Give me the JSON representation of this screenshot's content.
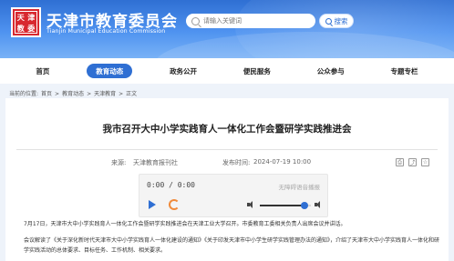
{
  "header": {
    "logo_chars": [
      "天",
      "津",
      "教",
      "委"
    ],
    "title": "天津市教育委员会",
    "subtitle": "Tianjin Municipal Education Commission",
    "search_placeholder": "请输入关键词",
    "search_button": "搜索"
  },
  "nav": {
    "items": [
      {
        "label": "首页",
        "active": false
      },
      {
        "label": "教育动态",
        "active": true
      },
      {
        "label": "政务公开",
        "active": false
      },
      {
        "label": "便民服务",
        "active": false
      },
      {
        "label": "公众参与",
        "active": false
      },
      {
        "label": "专题专栏",
        "active": false
      }
    ]
  },
  "breadcrumb": {
    "prefix": "当前的位置:",
    "items": [
      "首页",
      "教育动态",
      "天津教育",
      "正文"
    ],
    "separator": ">"
  },
  "article": {
    "title": "我市召开大中小学实践育人一体化工作会暨研学实践推进会",
    "source_label": "来源:",
    "source_value": "天津教育报刊社",
    "date_label": "发布时间:",
    "date_value": "2024-07-19 10:00",
    "paragraph_1": "7月17日，天津市大中小学实践育人一体化工作会暨研学实践推进会在天津工业大学召开。市委教育工委相关负责人出席会议并讲话。",
    "paragraph_2": "会议解读了《关于深化新时代天津市大中小学实践育人一体化建设的通知》《关于印发天津市中小学生研学实践管理办法的通知》，介绍了天津市大中小学实践育人一体化和研学实践活动的总体要求、目标任务、工作机制、相关要求。"
  },
  "player": {
    "time": "0:00 / 0:00",
    "hint": "无障碍语音播报",
    "volume_level": 0.88
  }
}
